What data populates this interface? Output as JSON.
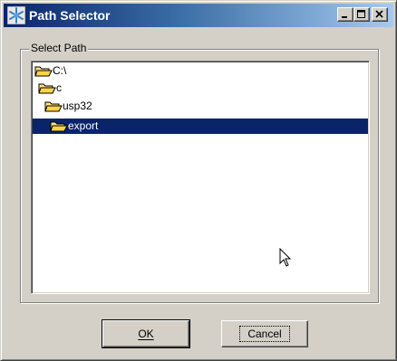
{
  "window": {
    "title": "Path Selector",
    "icon": "snowflake-app-icon",
    "controls": [
      "minimize",
      "maximize",
      "close"
    ]
  },
  "group": {
    "label": "Select Path"
  },
  "tree": {
    "items": [
      {
        "label": "C:\\",
        "icon": "open-folder-icon",
        "level": 0,
        "selected": false
      },
      {
        "label": "c",
        "icon": "open-folder-icon",
        "level": 1,
        "selected": false
      },
      {
        "label": "usp32",
        "icon": "open-folder-icon",
        "level": 2,
        "selected": false
      },
      {
        "label": "export",
        "icon": "open-folder-icon",
        "level": 3,
        "selected": true
      }
    ]
  },
  "buttons": {
    "ok": {
      "label": "OK",
      "mnemonic": "O"
    },
    "cancel": {
      "label": "Cancel",
      "mnemonic": "C"
    }
  },
  "colors": {
    "title_start": "#0a246a",
    "title_end": "#a6caf0",
    "face": "#d4d0c8",
    "selection": "#0a246a",
    "folder": "#ffd24a"
  }
}
